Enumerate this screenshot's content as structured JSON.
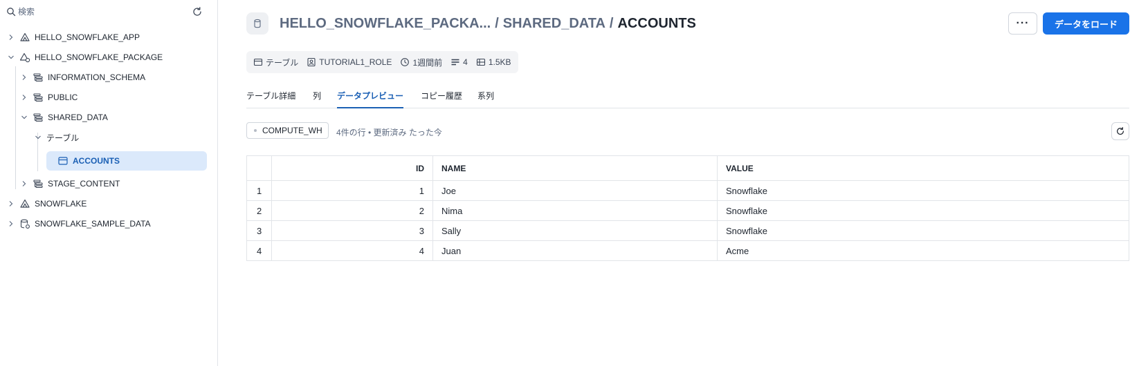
{
  "sidebar": {
    "search_placeholder": "検索",
    "items": [
      {
        "label": "HELLO_SNOWFLAKE_APP"
      },
      {
        "label": "HELLO_SNOWFLAKE_PACKAGE"
      },
      {
        "label": "INFORMATION_SCHEMA"
      },
      {
        "label": "PUBLIC"
      },
      {
        "label": "SHARED_DATA"
      },
      {
        "label": "テーブル"
      },
      {
        "label": "ACCOUNTS"
      },
      {
        "label": "STAGE_CONTENT"
      },
      {
        "label": "SNOWFLAKE"
      },
      {
        "label": "SNOWFLAKE_SAMPLE_DATA"
      }
    ]
  },
  "header": {
    "breadcrumb": [
      "HELLO_SNOWFLAKE_PACKA...",
      "/",
      "SHARED_DATA",
      "/",
      "ACCOUNTS"
    ],
    "more_label": "···",
    "load_label": "データをロード"
  },
  "meta": {
    "type": "テーブル",
    "role": "TUTORIAL1_ROLE",
    "time": "1週間前",
    "columns": "4",
    "size": "1.5KB"
  },
  "tabs": [
    "テーブル詳細",
    "列",
    "データプレビュー",
    "コピー履歴",
    "系列"
  ],
  "active_tab": "データプレビュー",
  "preview": {
    "warehouse": "COMPUTE_WH",
    "status": "4件の行 • 更新済み たった今"
  },
  "table": {
    "headers": [
      "ID",
      "NAME",
      "VALUE"
    ],
    "rows": [
      {
        "idx": "1",
        "id": "1",
        "name": "Joe",
        "value": "Snowflake"
      },
      {
        "idx": "2",
        "id": "2",
        "name": "Nima",
        "value": "Snowflake"
      },
      {
        "idx": "3",
        "id": "3",
        "name": "Sally",
        "value": "Snowflake"
      },
      {
        "idx": "4",
        "id": "4",
        "name": "Juan",
        "value": "Acme"
      }
    ]
  },
  "colors": {
    "accent": "#1a73e8",
    "selected_bg": "#dbe9fb",
    "selected_text": "#1a5fb4"
  }
}
